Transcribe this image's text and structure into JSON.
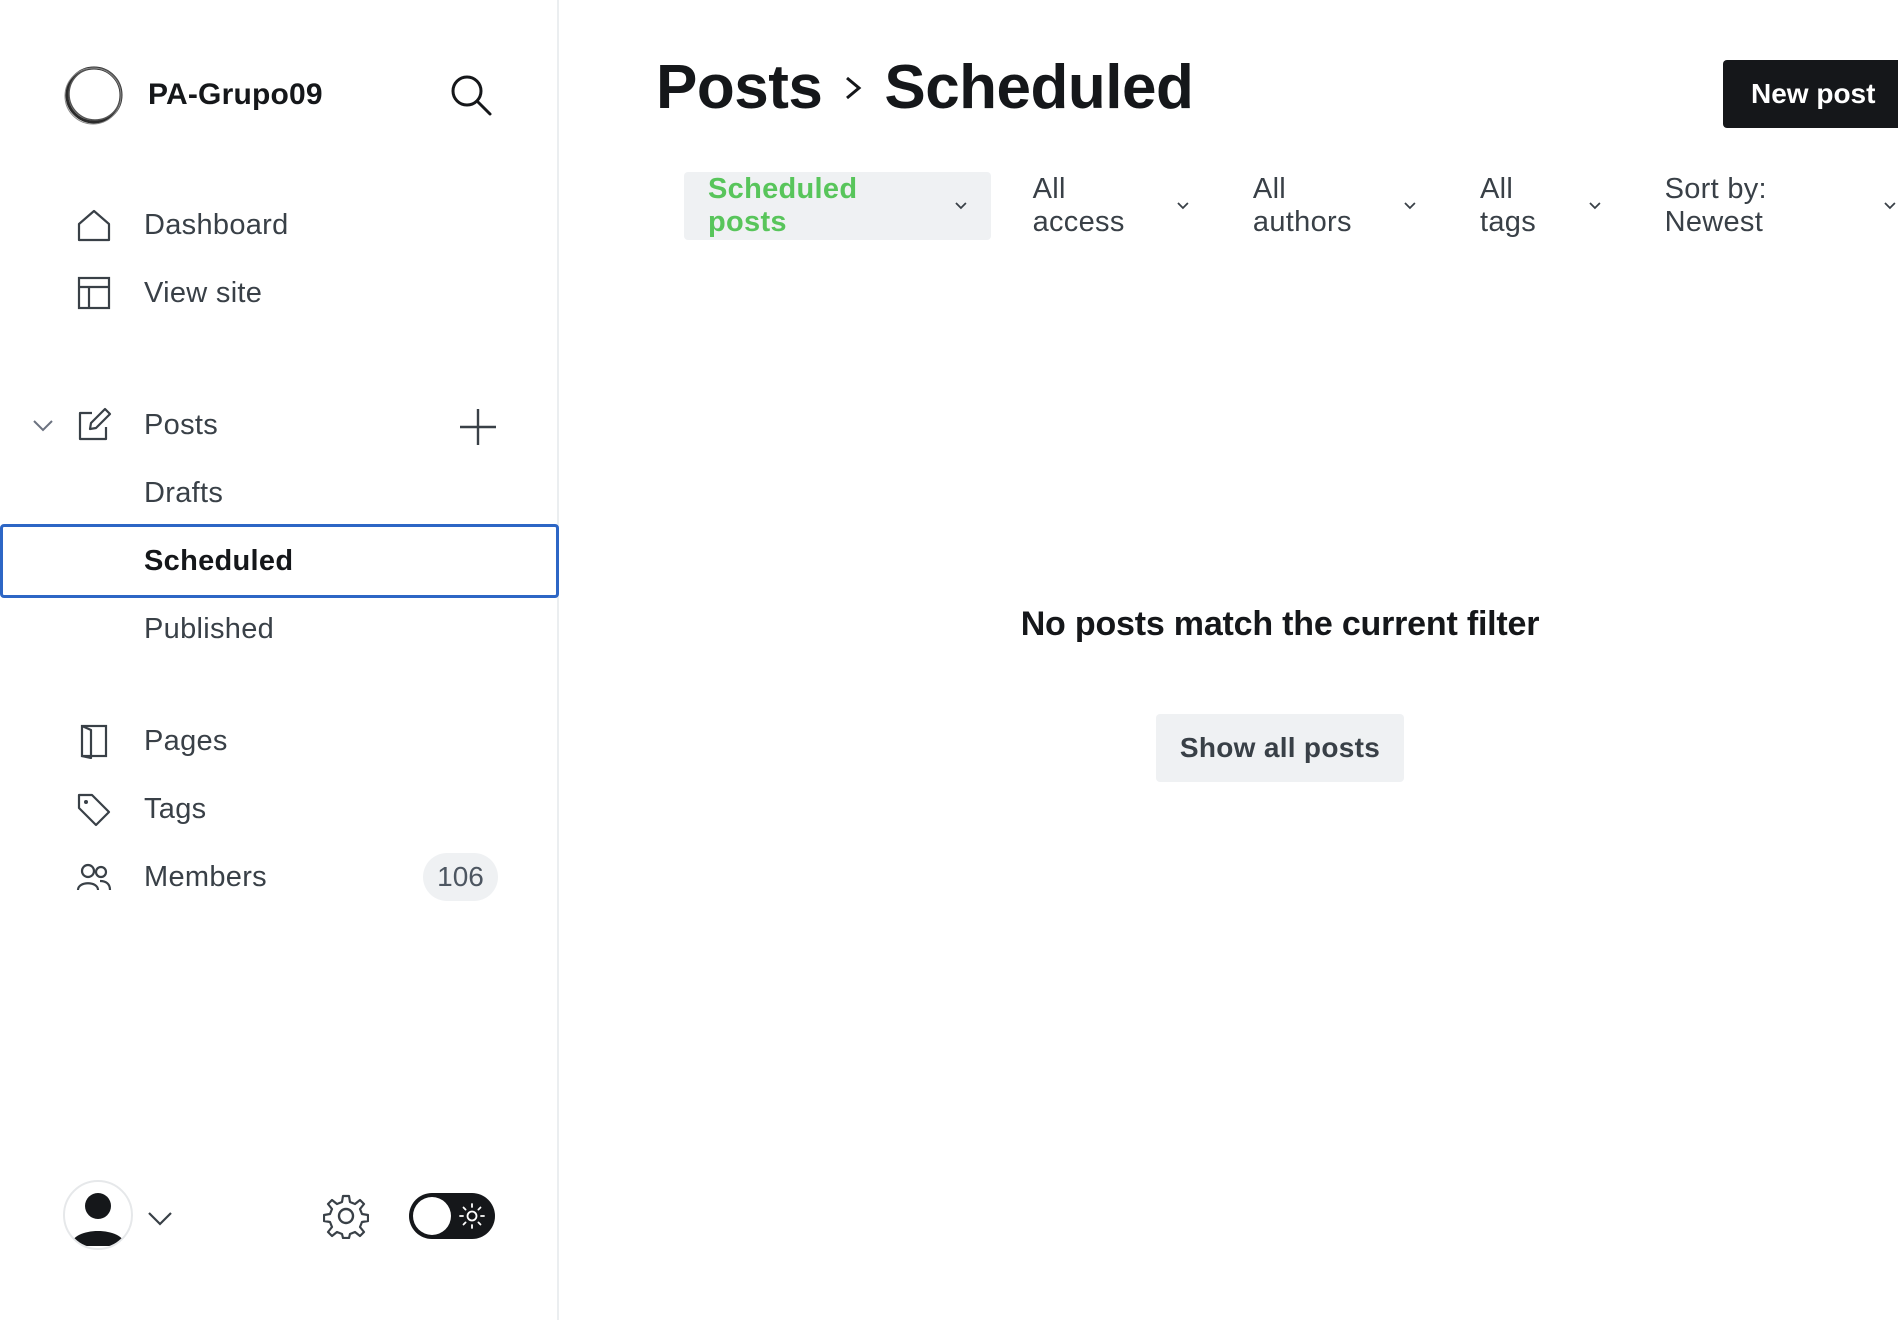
{
  "sidebar": {
    "site_name": "PA-Grupo09",
    "nav": [
      {
        "label": "Dashboard",
        "icon": "home-icon"
      },
      {
        "label": "View site",
        "icon": "layout-icon"
      }
    ],
    "posts": {
      "label": "Posts",
      "icon": "edit-icon",
      "sub_items": [
        {
          "label": "Drafts"
        },
        {
          "label": "Scheduled",
          "active": true
        },
        {
          "label": "Published"
        }
      ]
    },
    "secondary": [
      {
        "label": "Pages",
        "icon": "page-icon"
      },
      {
        "label": "Tags",
        "icon": "tag-icon"
      },
      {
        "label": "Members",
        "icon": "members-icon",
        "badge": "106"
      }
    ]
  },
  "header": {
    "breadcrumb_parent": "Posts",
    "breadcrumb_current": "Scheduled",
    "new_post_label": "New post"
  },
  "filters": {
    "type": "Scheduled posts",
    "access": "All access",
    "authors": "All authors",
    "tags": "All tags",
    "sort": "Sort by: Newest"
  },
  "empty_state": {
    "message": "No posts match the current filter",
    "button_label": "Show all posts"
  },
  "colors": {
    "accent_green": "#58c55b",
    "active_border": "#2d66c5",
    "dark": "#15171a"
  }
}
